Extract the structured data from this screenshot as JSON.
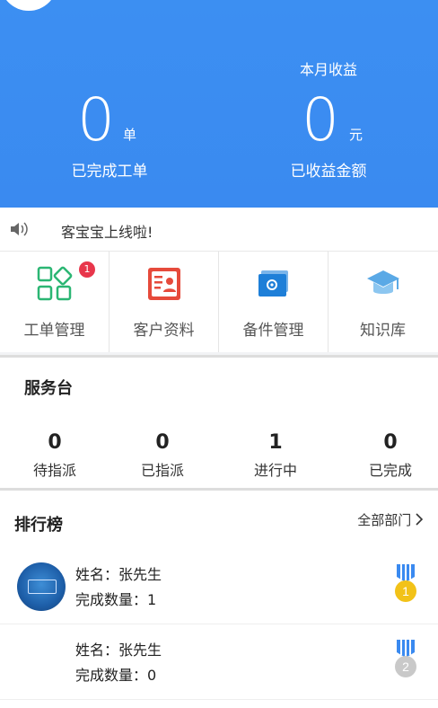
{
  "header": {
    "orders": {
      "value": "0",
      "unit": "单",
      "label": "已完成工单"
    },
    "income": {
      "caption": "本月收益",
      "value": "0",
      "unit": "元",
      "label": "已收益金额"
    }
  },
  "notice": {
    "text": "客宝宝上线啦!",
    "icon": "speaker-icon"
  },
  "menu": [
    {
      "label": "工单管理",
      "icon": "grid-apps-icon",
      "badge": "1",
      "color": "#2bb673"
    },
    {
      "label": "客户资料",
      "icon": "contact-card-icon",
      "color": "#e64a3b"
    },
    {
      "label": "备件管理",
      "icon": "parts-box-icon",
      "color": "#1e7fd8"
    },
    {
      "label": "知识库",
      "icon": "graduation-cap-icon",
      "color": "#5aa9e6"
    }
  ],
  "desk": {
    "title": "服务台",
    "items": [
      {
        "num": "0",
        "label": "待指派"
      },
      {
        "num": "0",
        "label": "已指派"
      },
      {
        "num": "1",
        "label": "进行中"
      },
      {
        "num": "0",
        "label": "已完成"
      }
    ]
  },
  "ranking": {
    "title": "排行榜",
    "filter": "全部部门 ",
    "rows": [
      {
        "name": "姓名：张先生",
        "count": "完成数量：1",
        "medal": "1",
        "medal_color": "#f2c218"
      },
      {
        "name": "姓名：张先生",
        "count": "完成数量：0",
        "medal": "2",
        "medal_color": "#c9c9c9"
      }
    ]
  },
  "colors": {
    "primary": "#3a8af0"
  }
}
